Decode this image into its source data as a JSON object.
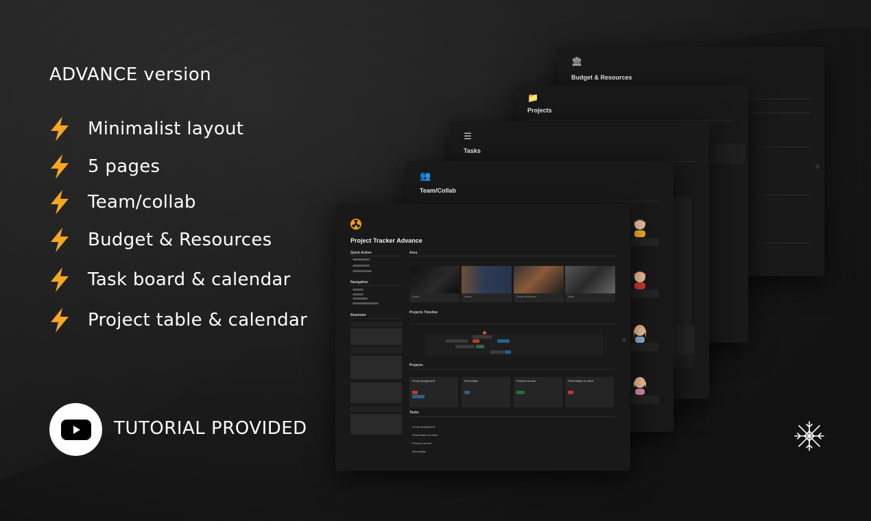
{
  "heading": "ADVANCE version",
  "features": [
    "Minimalist layout",
    "5 pages",
    "Team/collab",
    "Budget & Resources",
    "Task board & calendar",
    "Project table & calendar"
  ],
  "tutorial": "TUTORIAL PROVIDED",
  "icons": {
    "bolt": "lightning-bolt-icon",
    "youtube": "youtube-play-icon",
    "logo": "snowflake-logo-icon"
  },
  "colors": {
    "bolt": "#f5a623",
    "accent": "#f39c12",
    "background": "#161616"
  },
  "screens": {
    "budget": {
      "title": "Budget & Resources"
    },
    "projects": {
      "title": "Projects"
    },
    "tasks": {
      "title": "Tasks"
    },
    "team": {
      "title": "Team/Collab"
    },
    "main": {
      "title": "Project Tracker Advance",
      "quick_action": "Quick Action",
      "nav": "Navigation",
      "reminder": "Reminder",
      "area": "Area",
      "timeline": "Projects Timeline",
      "projects": "Projects",
      "tasks": "Tasks",
      "area_items": [
        "Study",
        "Home",
        "Online Business",
        "Work"
      ],
      "project_items": [
        "Group Assignment",
        "Renovation",
        "Product Launch",
        "Presentation to client"
      ],
      "task_items": [
        "Group Assignment",
        "Presentation to client",
        "Product Launch",
        "Renovation"
      ]
    }
  }
}
